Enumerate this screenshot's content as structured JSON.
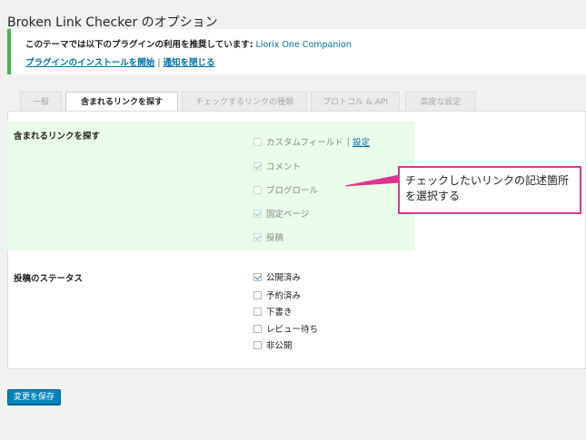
{
  "page": {
    "title": "Broken Link Checker のオプション"
  },
  "notice": {
    "text": "このテーマでは以下のプラグインの利用を推奨しています:",
    "plugin_link": "Llorix One Companion",
    "install_link": "プラグインのインストールを開始",
    "separator": "|",
    "dismiss_link": "通知を閉じる"
  },
  "tabs": [
    {
      "label": "一般",
      "active": false
    },
    {
      "label": "含まれるリンクを探す",
      "active": true
    },
    {
      "label": "チェックするリンクの種類",
      "active": false
    },
    {
      "label": "プロトコル & API",
      "active": false
    },
    {
      "label": "高度な設定",
      "active": false
    }
  ],
  "section_search": {
    "label": "含まれるリンクを探す",
    "items": [
      {
        "label": "カスタムフィールド",
        "checked": false,
        "disabled": true,
        "link": "設定"
      },
      {
        "label": "コメント",
        "checked": true,
        "disabled": true
      },
      {
        "label": "ブログロール",
        "checked": false,
        "disabled": true
      },
      {
        "label": "固定ページ",
        "checked": true,
        "disabled": true
      },
      {
        "label": "投稿",
        "checked": true,
        "disabled": true
      }
    ]
  },
  "section_status": {
    "label": "投稿のステータス",
    "items": [
      {
        "label": "公開済み",
        "checked": true
      },
      {
        "label": "予約済み",
        "checked": false
      },
      {
        "label": "下書き",
        "checked": false
      },
      {
        "label": "レビュー待ち",
        "checked": false
      },
      {
        "label": "非公開",
        "checked": false
      }
    ]
  },
  "callout": {
    "text": "チェックしたいリンクの記述箇所を選択する",
    "border_color": "#e0338f"
  },
  "save_button": {
    "label": "変更を保存"
  }
}
